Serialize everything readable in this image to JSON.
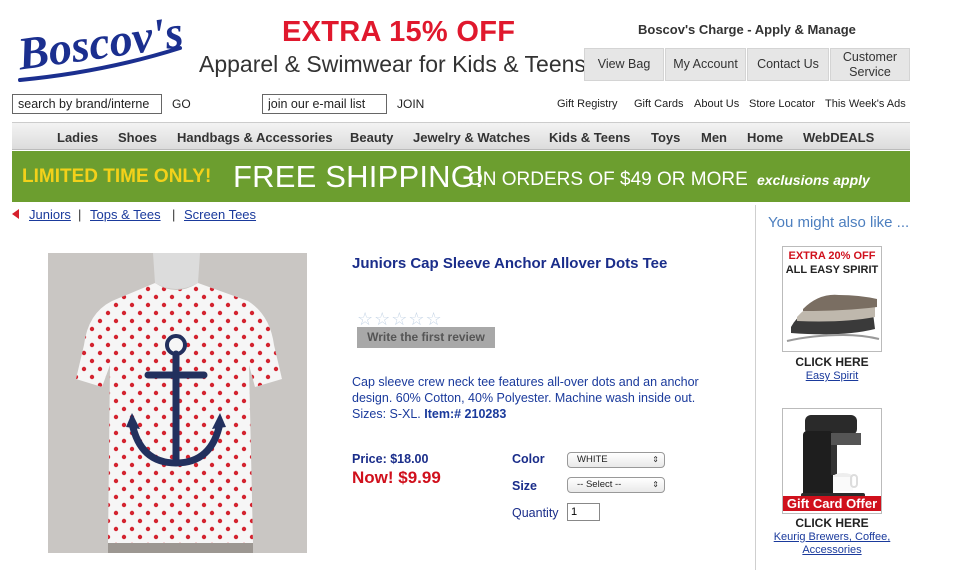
{
  "brand": {
    "logo_text": "Boscov's"
  },
  "promo": {
    "title": "EXTRA 15% OFF",
    "subtitle": "Apparel & Swimwear for Kids & Teens"
  },
  "header": {
    "charge_link": "Boscov's Charge - Apply & Manage",
    "buttons": {
      "view_bag": "View Bag",
      "my_account": "My Account",
      "contact_us": "Contact Us",
      "customer_service": "Customer Service"
    }
  },
  "search": {
    "value": "search by brand/interne",
    "go": "GO"
  },
  "email": {
    "value": "join our e-mail list",
    "join": "JOIN"
  },
  "utility_links": [
    "Gift Registry",
    "Gift Cards",
    "About Us",
    "Store Locator",
    "This Week's Ads"
  ],
  "nav": [
    "Ladies",
    "Shoes",
    "Handbags & Accessories",
    "Beauty",
    "Jewelry & Watches",
    "Kids & Teens",
    "Toys",
    "Men",
    "Home",
    "WebDEALS"
  ],
  "banner": {
    "limited": "LIMITED TIME ONLY!",
    "free_shipping": "FREE SHIPPING!",
    "orders": "ON ORDERS OF $49 OR MORE",
    "exclusions": "exclusions apply"
  },
  "breadcrumb": [
    "Juniors",
    "Tops & Tees",
    "Screen Tees"
  ],
  "breadcrumb_sep": "|",
  "product": {
    "title": "Juniors Cap Sleeve Anchor Allover Dots Tee",
    "stars": "☆☆☆☆☆",
    "review_button": "Write the first review",
    "description": "Cap sleeve crew neck tee features all-over dots and an anchor design. 60% Cotton, 40% Polyester. Machine wash inside out. Sizes: S-XL.",
    "item_number": "Item:# 210283",
    "price": "Price: $18.00",
    "now_price": "Now! $9.99",
    "color_label": "Color",
    "color_value": "WHITE",
    "size_label": "Size",
    "size_value": "-- Select --",
    "quantity_label": "Quantity",
    "quantity_value": "1"
  },
  "sidebar": {
    "heading": "You might also like ...",
    "ad1": {
      "headline1": "EXTRA 20% OFF",
      "headline2": "ALL EASY SPIRIT",
      "caption": "CLICK HERE",
      "link": "Easy Spirit"
    },
    "ad2": {
      "overlay": "Gift Card Offer",
      "caption": "CLICK HERE",
      "link": "Keurig Brewers, Coffee, Accessories"
    }
  },
  "colors": {
    "brand_blue": "#1a3a9c",
    "promo_red": "#e0182d",
    "banner_green": "#6c9e2f",
    "banner_yellow": "#f3d11a",
    "sale_red": "#d0101c"
  }
}
